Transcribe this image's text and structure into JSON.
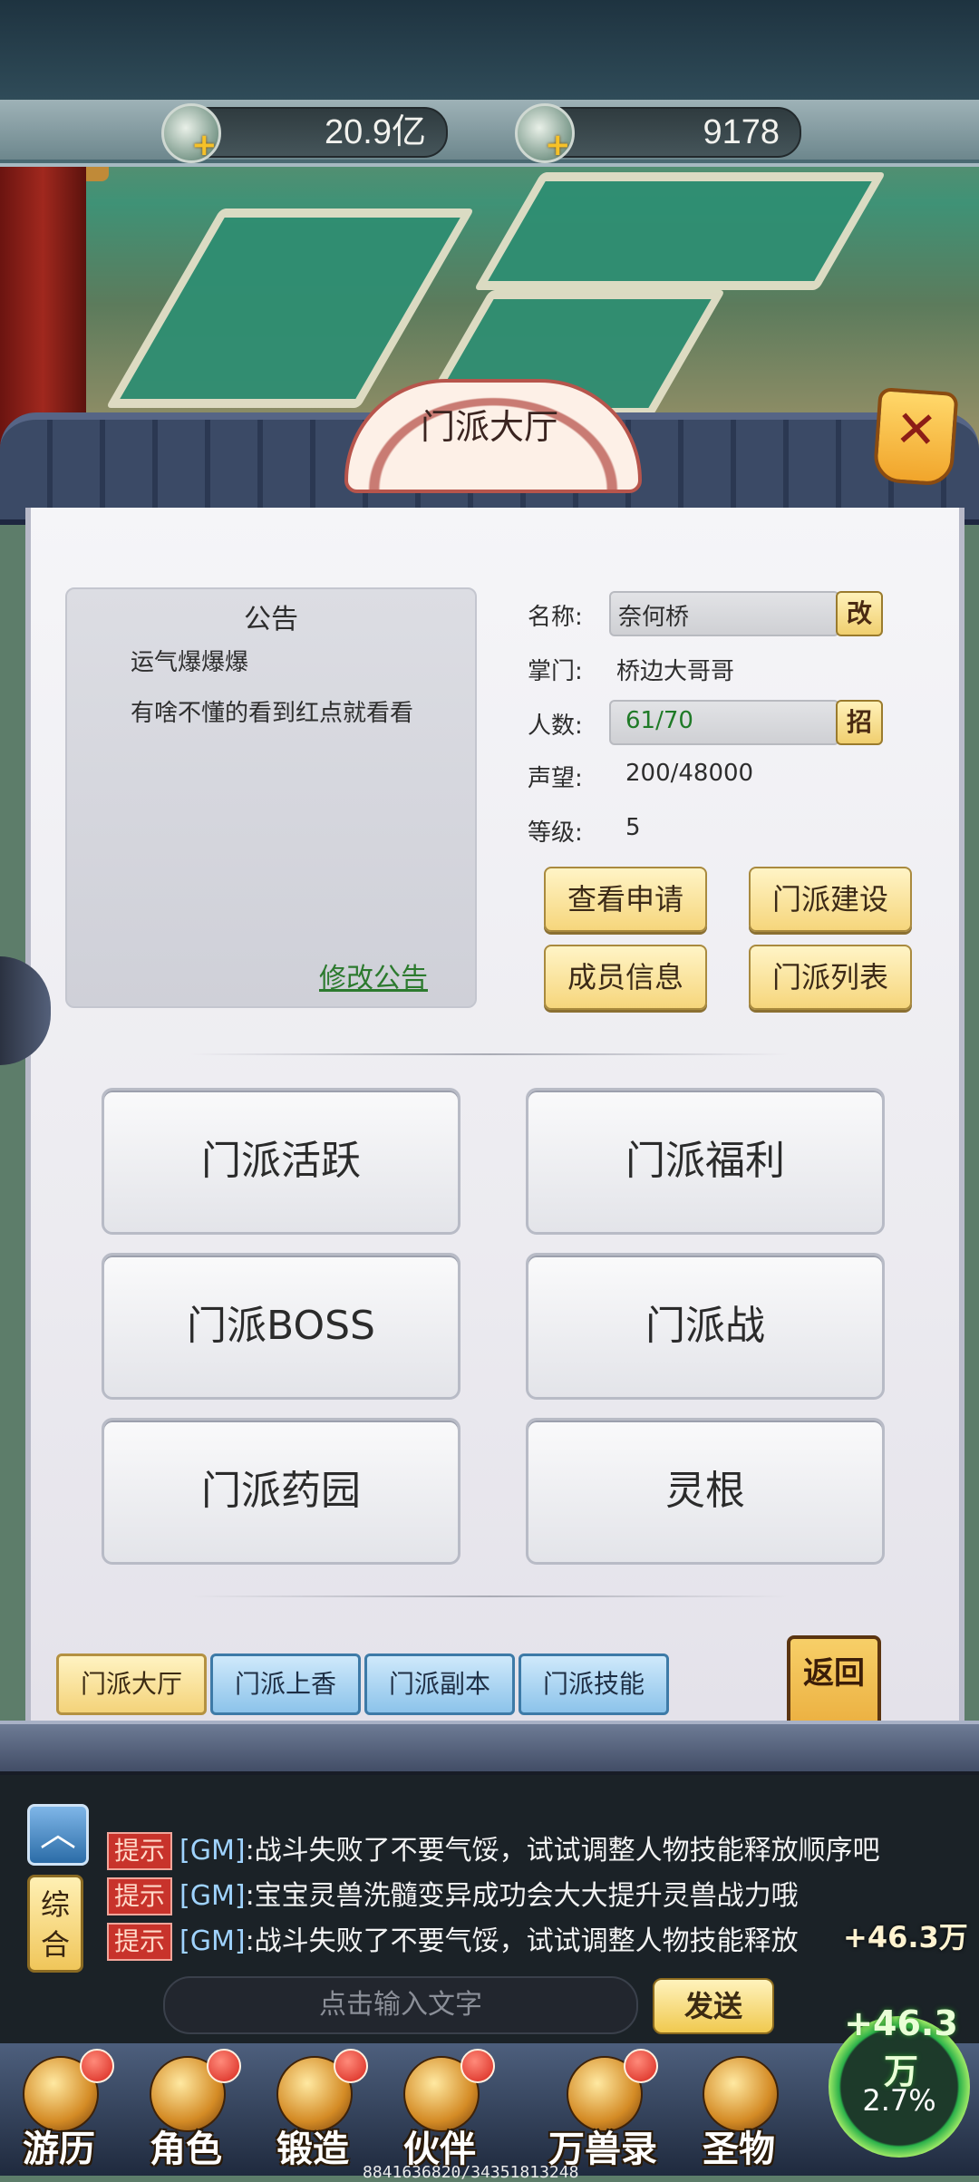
{
  "resources": [
    {
      "icon": "silver-coin-icon",
      "value": "20.9亿"
    },
    {
      "icon": "jade-coin-icon",
      "value": "9178"
    }
  ],
  "panel": {
    "title": "门派大厅",
    "notice": {
      "title": "公告",
      "lines": [
        "运气爆爆爆",
        "有啥不懂的看到红点就看看"
      ],
      "edit_label": "修改公告"
    },
    "info": {
      "name_label": "名称:",
      "name_value": "奈何桥",
      "name_button": "改",
      "leader_label": "掌门:",
      "leader_value": "桥边大哥哥",
      "members_label": "人数:",
      "members_value": "61/70",
      "members_button": "招",
      "prestige_label": "声望:",
      "prestige_value": "200/48000",
      "level_label": "等级:",
      "level_value": "5"
    },
    "action_buttons": [
      "查看申请",
      "门派建设",
      "成员信息",
      "门派列表"
    ],
    "feature_buttons": [
      "门派活跃",
      "门派福利",
      "门派BOSS",
      "门派战",
      "门派药园",
      "灵根"
    ],
    "tabs": [
      "门派大厅",
      "门派上香",
      "门派副本",
      "门派技能"
    ],
    "active_tab": "门派大厅",
    "return_label": "返回"
  },
  "chat": {
    "mode_label": "综合",
    "messages": [
      {
        "tag": "提示",
        "sender": "[GM]",
        "text": ":战斗失败了不要气馁，试试调整人物技能释放顺序吧"
      },
      {
        "tag": "提示",
        "sender": "[GM]",
        "text": ":宝宝灵兽洗髓变异成功会大大提升灵兽战力哦"
      },
      {
        "tag": "提示",
        "sender": "[GM]",
        "text": ":战斗失败了不要气馁，试试调整人物技能释放"
      }
    ],
    "input_placeholder": "点击输入文字",
    "send_label": "发送",
    "float_text": "+46.3万"
  },
  "nav": {
    "items": [
      {
        "label": "游历",
        "icon": "crossed-swords-icon"
      },
      {
        "label": "角色",
        "icon": "warrior-icon"
      },
      {
        "label": "锻造",
        "icon": "anvil-icon"
      },
      {
        "label": "伙伴",
        "icon": "partner-icon"
      },
      {
        "label": "万兽录",
        "icon": "beast-icon"
      },
      {
        "label": "圣物",
        "icon": "relic-icon"
      }
    ],
    "bonus_text": "+46.3万",
    "ring_percent": "2.7%",
    "exp_text": "8841636820/34351813248"
  }
}
